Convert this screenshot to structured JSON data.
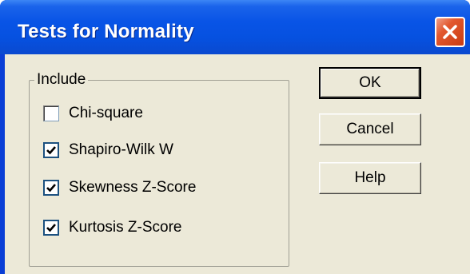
{
  "window": {
    "title": "Tests for Normality"
  },
  "include_group": {
    "legend": "Include",
    "options": [
      {
        "label": "Chi-square",
        "checked": false
      },
      {
        "label": "Shapiro-Wilk W",
        "checked": true
      },
      {
        "label": "Skewness Z-Score",
        "checked": true
      },
      {
        "label": "Kurtosis Z-Score",
        "checked": true
      }
    ]
  },
  "buttons": {
    "ok_label": "OK",
    "cancel_label": "Cancel",
    "help_label": "Help"
  },
  "icons": {
    "close": "close-icon",
    "check": "checkmark-icon"
  },
  "colors": {
    "titlebar": "#0954e6",
    "close_button": "#e2582f",
    "dialog_face": "#ece9d8"
  }
}
